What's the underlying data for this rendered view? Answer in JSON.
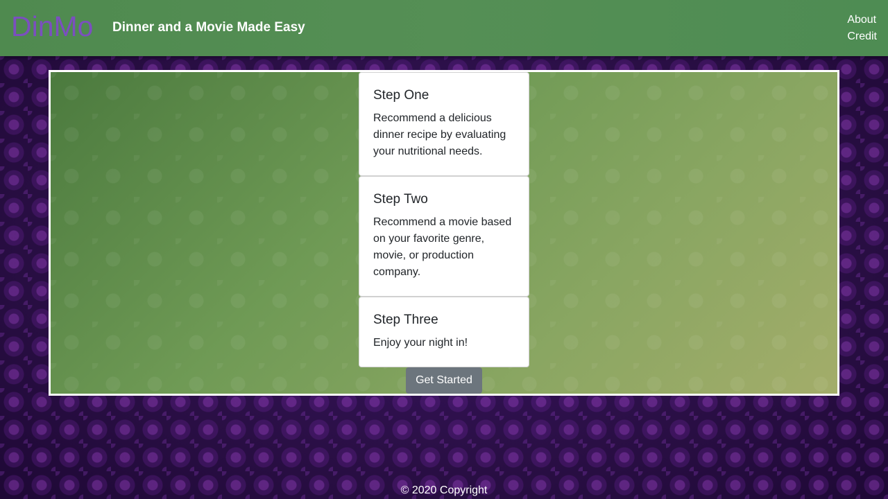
{
  "header": {
    "brand": "DinMo",
    "tagline": "Dinner and a Movie Made Easy",
    "nav": [
      {
        "label": "About"
      },
      {
        "label": "Credit"
      }
    ]
  },
  "steps": [
    {
      "title": "Step One",
      "text": "Recommend a delicious dinner recipe by evaluating your nutritional needs."
    },
    {
      "title": "Step Two",
      "text": "Recommend a movie based on your favorite genre, movie, or production company."
    },
    {
      "title": "Step Three",
      "text": "Enjoy your night in!"
    }
  ],
  "cta": {
    "label": "Get Started"
  },
  "footer": {
    "copyright": "© 2020 Copyright"
  },
  "colors": {
    "header": "#558f55",
    "brand": "#7b4fbf",
    "background": "#2a0f45",
    "button": "#6c757d"
  }
}
